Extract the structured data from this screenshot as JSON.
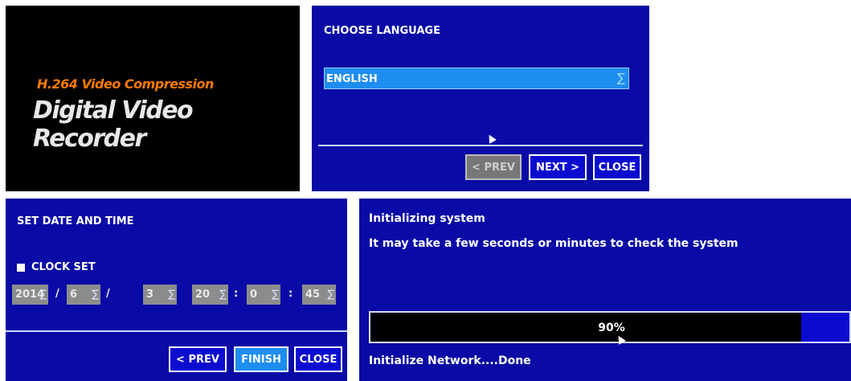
{
  "splash": {
    "subtitle": "H.264 Video Compression",
    "title": "Digital Video Recorder"
  },
  "language": {
    "heading": "CHOOSE LANGUAGE",
    "selected": "ENGLISH",
    "dropdown_icon": "sigma-dropdown-icon",
    "buttons": {
      "prev": "< PREV",
      "next": "NEXT >",
      "close": "CLOSE"
    }
  },
  "datetime": {
    "heading": "SET DATE AND TIME",
    "clock_set_label": "CLOCK SET",
    "year": "2014",
    "month": "6",
    "day": "3",
    "hour": "20",
    "minute": "0",
    "second": "45",
    "date_sep": "/",
    "time_sep": ":",
    "buttons": {
      "prev": "< PREV",
      "finish": "FINISH",
      "close": "CLOSE"
    }
  },
  "initializing": {
    "title": "Initializing system",
    "message": "It may take a few seconds or minutes to check the system",
    "progress_label": "90%",
    "progress_value": 0.9,
    "status": "Initialize Network....Done"
  },
  "colors": {
    "panel_bg": "#0a0aa6",
    "selected_bg": "#1e8df0",
    "splash_accent": "#ff7a00"
  }
}
